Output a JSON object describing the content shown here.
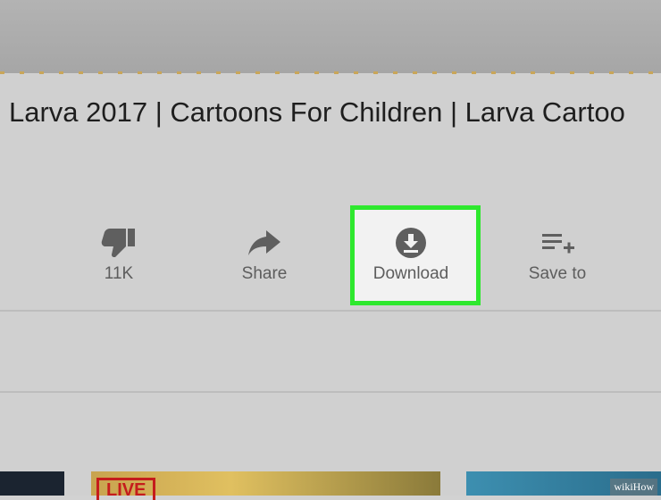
{
  "video": {
    "title": "Larva 2017 | Cartoons For Children | Larva Cartoo"
  },
  "actions": {
    "dislike_label": "11K",
    "share_label": "Share",
    "download_label": "Download",
    "save_label": "Save to"
  },
  "thumbnails": {
    "live_badge": "LIVE"
  },
  "watermark": {
    "text": "wikiHow"
  },
  "icons": {
    "dislike": "thumbs-down-icon",
    "share": "share-arrow-icon",
    "download": "download-icon",
    "save": "playlist-add-icon"
  },
  "colors": {
    "highlight": "#2ee82e",
    "live": "#c51c1c"
  }
}
